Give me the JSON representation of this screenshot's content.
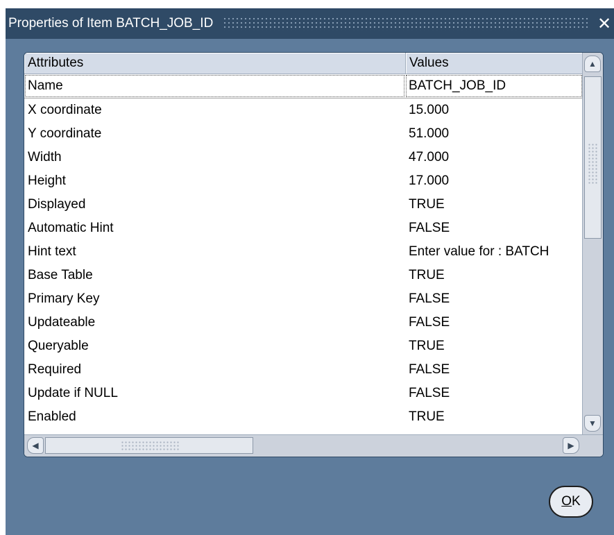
{
  "window": {
    "title": "Properties of Item BATCH_JOB_ID",
    "close_glyph": "✕"
  },
  "table": {
    "headers": [
      "Attributes",
      "Values"
    ],
    "rows": [
      {
        "attribute": "Name",
        "value": "BATCH_JOB_ID"
      },
      {
        "attribute": "X coordinate",
        "value": "15.000"
      },
      {
        "attribute": "Y coordinate",
        "value": "51.000"
      },
      {
        "attribute": "Width",
        "value": "47.000"
      },
      {
        "attribute": "Height",
        "value": "17.000"
      },
      {
        "attribute": "Displayed",
        "value": "TRUE"
      },
      {
        "attribute": "Automatic Hint",
        "value": "FALSE"
      },
      {
        "attribute": "Hint text",
        "value": "Enter value for : BATCH"
      },
      {
        "attribute": "Base Table",
        "value": "TRUE"
      },
      {
        "attribute": "Primary Key",
        "value": "FALSE"
      },
      {
        "attribute": "Updateable",
        "value": "FALSE"
      },
      {
        "attribute": "Queryable",
        "value": "TRUE"
      },
      {
        "attribute": "Required",
        "value": "FALSE"
      },
      {
        "attribute": "Update if NULL",
        "value": "FALSE"
      },
      {
        "attribute": "Enabled",
        "value": "TRUE"
      }
    ],
    "selected_row_index": 0
  },
  "buttons": {
    "ok_mnemonic": "O",
    "ok_rest": "K"
  },
  "icons": {
    "close": "close-icon",
    "scroll_up": "arrow-up-icon",
    "scroll_down": "arrow-down-icon",
    "scroll_left": "arrow-left-icon",
    "scroll_right": "arrow-right-icon"
  },
  "colors": {
    "window_bg": "#5e7c9c",
    "titlebar_bg": "#2f4a66",
    "header_bg": "#d4dce8"
  }
}
